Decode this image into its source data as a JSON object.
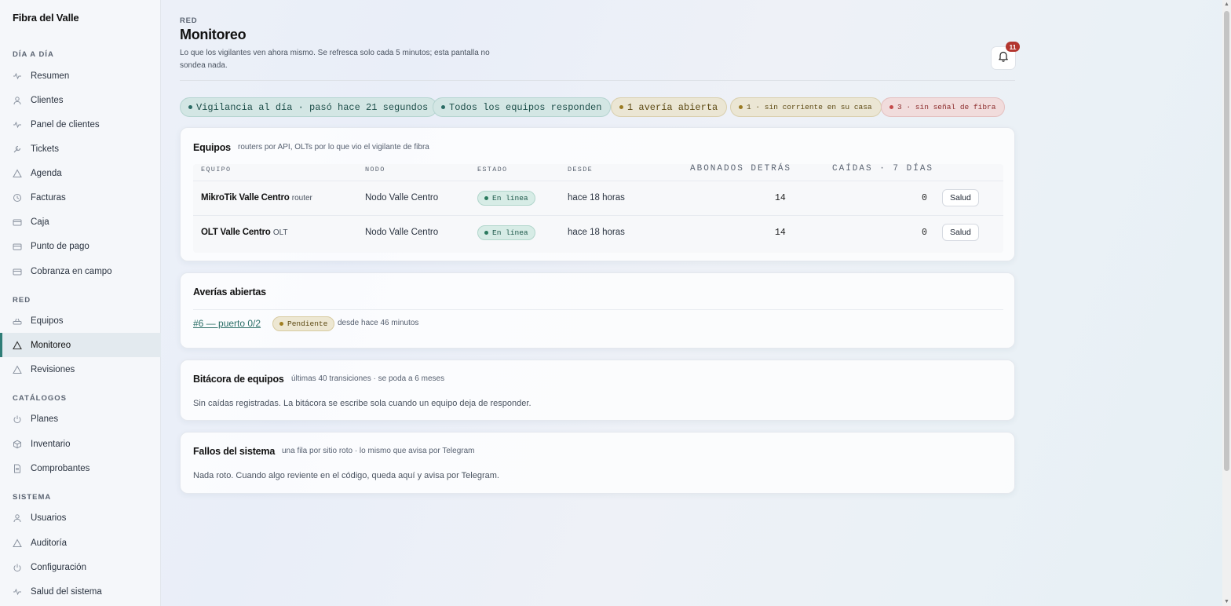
{
  "app": {
    "brand": "Fibra del Valle"
  },
  "sidebar": {
    "sections": [
      "DÍA A DÍA",
      "RED",
      "CATÁLOGOS",
      "SISTEMA"
    ],
    "items": [
      {
        "label": "Resumen",
        "icon": "pulse-icon"
      },
      {
        "label": "Clientes",
        "icon": "user-icon"
      },
      {
        "label": "Panel de clientes",
        "icon": "pulse-icon"
      },
      {
        "label": "Tickets",
        "icon": "wrench-icon"
      },
      {
        "label": "Agenda",
        "icon": "warning-icon"
      },
      {
        "label": "Facturas",
        "icon": "clock-icon"
      },
      {
        "label": "Caja",
        "icon": "card-icon"
      },
      {
        "label": "Punto de pago",
        "icon": "card-icon"
      },
      {
        "label": "Cobranza en campo",
        "icon": "card-icon"
      },
      {
        "label": "Equipos",
        "icon": "router-icon"
      },
      {
        "label": "Monitoreo",
        "icon": "warning-icon"
      },
      {
        "label": "Revisiones",
        "icon": "warning-icon"
      },
      {
        "label": "Planes",
        "icon": "power-icon"
      },
      {
        "label": "Inventario",
        "icon": "box-icon"
      },
      {
        "label": "Comprobantes",
        "icon": "document-icon"
      },
      {
        "label": "Usuarios",
        "icon": "user-icon"
      },
      {
        "label": "Auditoría",
        "icon": "warning-icon"
      },
      {
        "label": "Configuración",
        "icon": "power-icon"
      },
      {
        "label": "Salud del sistema",
        "icon": "pulse-icon"
      }
    ],
    "active": "Monitoreo"
  },
  "header": {
    "kicker": "RED",
    "title": "Monitoreo",
    "subtitle": "Lo que los vigilantes ven ahora mismo. Se refresca solo cada 5 minutos; esta pantalla no sondea nada.",
    "notifications": "11"
  },
  "chips": [
    "Vigilancia al día · pasó hace 21 segundos",
    "Todos los equipos responden",
    "1 avería abierta",
    "1 · sin corriente en su casa",
    "3 · sin señal de fibra"
  ],
  "equipos": {
    "title": "Equipos",
    "note": "routers por API, OLTs por lo que vio el vigilante de fibra",
    "columns": [
      "EQUIPO",
      "NODO",
      "ESTADO",
      "DESDE",
      "ABONADOS DETRÁS",
      "CAÍDAS · 7 DÍAS"
    ],
    "rows": [
      {
        "name": "MikroTik Valle Centro",
        "kind": "router",
        "node": "Nodo Valle Centro",
        "status": "En línea",
        "since": "hace 18 horas",
        "subscribers": "14",
        "drops": "0",
        "action": "Salud"
      },
      {
        "name": "OLT Valle Centro",
        "kind": "OLT",
        "node": "Nodo Valle Centro",
        "status": "En línea",
        "since": "hace 18 horas",
        "subscribers": "14",
        "drops": "0",
        "action": "Salud"
      }
    ]
  },
  "averias": {
    "title": "Averías abiertas",
    "items": [
      {
        "link": "#6 — puerto 0/2",
        "status": "Pendiente",
        "since": "desde hace 46 minutos"
      }
    ]
  },
  "bitacora": {
    "title": "Bitácora de equipos",
    "note": "últimas 40 transiciones · se poda a 6 meses",
    "body": "Sin caídas registradas. La bitácora se escribe sola cuando un equipo deja de responder."
  },
  "fallos": {
    "title": "Fallos del sistema",
    "note": "una fila por sitio roto · lo mismo que avisa por Telegram",
    "body": "Nada roto. Cuando algo reviente en el código, queda aquí y avisa por Telegram."
  }
}
